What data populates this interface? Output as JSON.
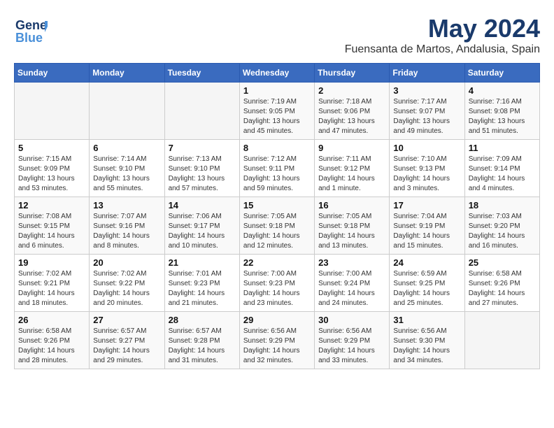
{
  "header": {
    "logo_line1": "General",
    "logo_line2": "Blue",
    "month": "May 2024",
    "location": "Fuensanta de Martos, Andalusia, Spain"
  },
  "days_of_week": [
    "Sunday",
    "Monday",
    "Tuesday",
    "Wednesday",
    "Thursday",
    "Friday",
    "Saturday"
  ],
  "weeks": [
    [
      {
        "day": "",
        "info": ""
      },
      {
        "day": "",
        "info": ""
      },
      {
        "day": "",
        "info": ""
      },
      {
        "day": "1",
        "info": "Sunrise: 7:19 AM\nSunset: 9:05 PM\nDaylight: 13 hours\nand 45 minutes."
      },
      {
        "day": "2",
        "info": "Sunrise: 7:18 AM\nSunset: 9:06 PM\nDaylight: 13 hours\nand 47 minutes."
      },
      {
        "day": "3",
        "info": "Sunrise: 7:17 AM\nSunset: 9:07 PM\nDaylight: 13 hours\nand 49 minutes."
      },
      {
        "day": "4",
        "info": "Sunrise: 7:16 AM\nSunset: 9:08 PM\nDaylight: 13 hours\nand 51 minutes."
      }
    ],
    [
      {
        "day": "5",
        "info": "Sunrise: 7:15 AM\nSunset: 9:09 PM\nDaylight: 13 hours\nand 53 minutes."
      },
      {
        "day": "6",
        "info": "Sunrise: 7:14 AM\nSunset: 9:10 PM\nDaylight: 13 hours\nand 55 minutes."
      },
      {
        "day": "7",
        "info": "Sunrise: 7:13 AM\nSunset: 9:10 PM\nDaylight: 13 hours\nand 57 minutes."
      },
      {
        "day": "8",
        "info": "Sunrise: 7:12 AM\nSunset: 9:11 PM\nDaylight: 13 hours\nand 59 minutes."
      },
      {
        "day": "9",
        "info": "Sunrise: 7:11 AM\nSunset: 9:12 PM\nDaylight: 14 hours\nand 1 minute."
      },
      {
        "day": "10",
        "info": "Sunrise: 7:10 AM\nSunset: 9:13 PM\nDaylight: 14 hours\nand 3 minutes."
      },
      {
        "day": "11",
        "info": "Sunrise: 7:09 AM\nSunset: 9:14 PM\nDaylight: 14 hours\nand 4 minutes."
      }
    ],
    [
      {
        "day": "12",
        "info": "Sunrise: 7:08 AM\nSunset: 9:15 PM\nDaylight: 14 hours\nand 6 minutes."
      },
      {
        "day": "13",
        "info": "Sunrise: 7:07 AM\nSunset: 9:16 PM\nDaylight: 14 hours\nand 8 minutes."
      },
      {
        "day": "14",
        "info": "Sunrise: 7:06 AM\nSunset: 9:17 PM\nDaylight: 14 hours\nand 10 minutes."
      },
      {
        "day": "15",
        "info": "Sunrise: 7:05 AM\nSunset: 9:18 PM\nDaylight: 14 hours\nand 12 minutes."
      },
      {
        "day": "16",
        "info": "Sunrise: 7:05 AM\nSunset: 9:18 PM\nDaylight: 14 hours\nand 13 minutes."
      },
      {
        "day": "17",
        "info": "Sunrise: 7:04 AM\nSunset: 9:19 PM\nDaylight: 14 hours\nand 15 minutes."
      },
      {
        "day": "18",
        "info": "Sunrise: 7:03 AM\nSunset: 9:20 PM\nDaylight: 14 hours\nand 16 minutes."
      }
    ],
    [
      {
        "day": "19",
        "info": "Sunrise: 7:02 AM\nSunset: 9:21 PM\nDaylight: 14 hours\nand 18 minutes."
      },
      {
        "day": "20",
        "info": "Sunrise: 7:02 AM\nSunset: 9:22 PM\nDaylight: 14 hours\nand 20 minutes."
      },
      {
        "day": "21",
        "info": "Sunrise: 7:01 AM\nSunset: 9:23 PM\nDaylight: 14 hours\nand 21 minutes."
      },
      {
        "day": "22",
        "info": "Sunrise: 7:00 AM\nSunset: 9:23 PM\nDaylight: 14 hours\nand 23 minutes."
      },
      {
        "day": "23",
        "info": "Sunrise: 7:00 AM\nSunset: 9:24 PM\nDaylight: 14 hours\nand 24 minutes."
      },
      {
        "day": "24",
        "info": "Sunrise: 6:59 AM\nSunset: 9:25 PM\nDaylight: 14 hours\nand 25 minutes."
      },
      {
        "day": "25",
        "info": "Sunrise: 6:58 AM\nSunset: 9:26 PM\nDaylight: 14 hours\nand 27 minutes."
      }
    ],
    [
      {
        "day": "26",
        "info": "Sunrise: 6:58 AM\nSunset: 9:26 PM\nDaylight: 14 hours\nand 28 minutes."
      },
      {
        "day": "27",
        "info": "Sunrise: 6:57 AM\nSunset: 9:27 PM\nDaylight: 14 hours\nand 29 minutes."
      },
      {
        "day": "28",
        "info": "Sunrise: 6:57 AM\nSunset: 9:28 PM\nDaylight: 14 hours\nand 31 minutes."
      },
      {
        "day": "29",
        "info": "Sunrise: 6:56 AM\nSunset: 9:29 PM\nDaylight: 14 hours\nand 32 minutes."
      },
      {
        "day": "30",
        "info": "Sunrise: 6:56 AM\nSunset: 9:29 PM\nDaylight: 14 hours\nand 33 minutes."
      },
      {
        "day": "31",
        "info": "Sunrise: 6:56 AM\nSunset: 9:30 PM\nDaylight: 14 hours\nand 34 minutes."
      },
      {
        "day": "",
        "info": ""
      }
    ]
  ]
}
